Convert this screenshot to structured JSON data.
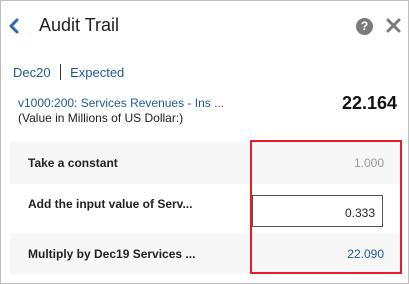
{
  "header": {
    "title": "Audit Trail",
    "help_glyph": "?",
    "icons": {
      "back": "chevron-left-icon",
      "help": "help-icon",
      "close": "close-icon"
    }
  },
  "links": {
    "period": "Dec20",
    "scenario": "Expected"
  },
  "account": {
    "name": "v1000:200: Services Revenues - Ins ...",
    "subtitle": "(Value in Millions of US Dollar:)",
    "value": "22.164"
  },
  "steps": [
    {
      "label": "Take a constant",
      "value": "1.000"
    },
    {
      "label": "Add the input value of Serv...",
      "value": "0.333"
    },
    {
      "label": "Multiply by Dec19 Services ...",
      "value": "22.090"
    }
  ],
  "colors": {
    "link": "#1f5a96",
    "highlight": "#e11d2b",
    "muted_value": "#9a9a9a"
  }
}
